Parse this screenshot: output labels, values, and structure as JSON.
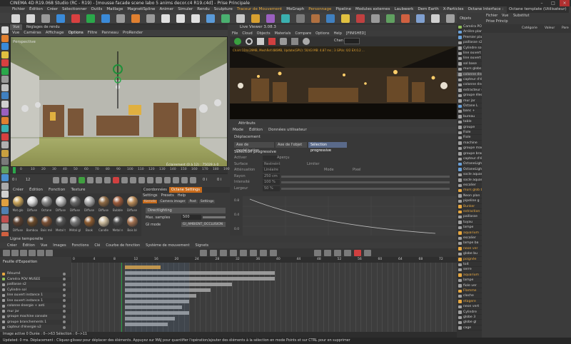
{
  "window": {
    "title": "CINEMA 4D R19.068 Studio (RC - R19) - [mousse facade scene labo 5 anims decor.c4 R19.c4d] - Prise Principale"
  },
  "menubar": [
    "Fichier",
    "Édition",
    "Créer",
    "Sélectionner",
    "Outils",
    "Maillage",
    "MagnetiSpline",
    "Animer",
    "Simuler",
    "Rendu",
    "Sculpture",
    "Traceur de Mouvement",
    "MoGraph",
    "Personnage",
    "Pipeline",
    "Modules externes",
    "Laubwerk",
    "Dem Earth",
    "X-Particles",
    "Octane",
    "Redshift",
    "Script",
    "Fenêtre",
    "Aide"
  ],
  "menubar_highlight": [
    "Traceur de Mouvement",
    "Personnage",
    "Fenêtre"
  ],
  "right_menubar": {
    "interface_label": "Interface :",
    "interface_value": "Octane template (Utilisateur)"
  },
  "viewport": {
    "tabs": [
      "Vue",
      "Réglages de rendu"
    ],
    "menu": [
      "Vue",
      "Caméras",
      "Affichage",
      "Options",
      "Filtre",
      "Panneau",
      "ProRender"
    ],
    "label": "Perspective",
    "overlay_text": "Éclairement (0 à 12) : 75029 à 0",
    "ruler_ticks": [
      "0",
      "10",
      "20",
      "30",
      "40",
      "50",
      "60",
      "70",
      "80",
      "90",
      "100",
      "110",
      "120",
      "130",
      "140",
      "150",
      "160",
      "170",
      "180",
      "190"
    ],
    "frame_start": "0 i",
    "frame_current": "12",
    "frame_end": "0 i",
    "fps_field": "0 i"
  },
  "live_viewer": {
    "title": "Live Viewer 3.08.3",
    "menu": [
      "File",
      "Cloud",
      "Objects",
      "Materials",
      "Compare",
      "Options",
      "Help",
      "[FINISHED]"
    ],
    "channel": "Chan",
    "status_text": "Chars:11to:29MB, MeshRef:486MB, Update(GPU): 50/43 MB: 4.87 ms ; 3 GPUs: 0/2 EX:0.2 ..."
  },
  "attributes": {
    "title": "Attributs",
    "menu": [
      "Mode",
      "Édition",
      "Données utilisateur"
    ],
    "object": "Déplacement",
    "tabs": [
      "Axe de modélisation",
      "Axe de l'objet",
      "Sélection progressive"
    ],
    "section": "Sélection progressive",
    "rows": [
      {
        "label": "Activer",
        "value": ""
      },
      {
        "label": "Surface",
        "value": "Restreint"
      },
      {
        "label": "Atténuation",
        "value": "Linéaire"
      },
      {
        "label": "Rayon",
        "value": "250 cm"
      },
      {
        "label": "Intensité",
        "value": "100 %"
      },
      {
        "label": "Largeur",
        "value": "50 %"
      }
    ],
    "extra_labels": [
      "Aperçu",
      "Limiter",
      "Mode",
      "Pixel"
    ],
    "graph_ticks": [
      "0.8",
      "0.4",
      "0.0"
    ]
  },
  "materials": {
    "menu": [
      "Créer",
      "Édition",
      "Fonction",
      "Texture"
    ],
    "items": [
      {
        "label": "Mat.glo",
        "color": "#c8a35a"
      },
      {
        "label": "Diffuse",
        "color": "#d8d8d8"
      },
      {
        "label": "Octane",
        "color": "#8a8a8a"
      },
      {
        "label": "Diffuse",
        "color": "#b9b9b9"
      },
      {
        "label": "Diffuse",
        "color": "#6a6a6a"
      },
      {
        "label": "Diffuse",
        "color": "#aaaaaa"
      },
      {
        "label": "Diffuse",
        "color": "#8f6b45"
      },
      {
        "label": "Bubble",
        "color": "#9b5a3a"
      },
      {
        "label": "Diffuse",
        "color": "#b88a58"
      },
      {
        "label": "Diffuse",
        "color": "#5a4030"
      },
      {
        "label": "Bambou",
        "color": "#6a4a2a"
      },
      {
        "label": "Bois mé",
        "color": "#7a5035"
      },
      {
        "label": "Metal t",
        "color": "#555555"
      },
      {
        "label": "Métal gl",
        "color": "#777777"
      },
      {
        "label": "Book",
        "color": "#8a5a30"
      },
      {
        "label": "Candle",
        "color": "#c8b89a"
      },
      {
        "label": "Metal n",
        "color": "#4a4a4a"
      },
      {
        "label": "Bois bl",
        "color": "#a07050"
      }
    ]
  },
  "octane_settings": {
    "tabs": [
      "Coordonnées",
      "Octane Settings"
    ],
    "subtabs": [
      "Settings",
      "Presets",
      "Help"
    ],
    "kernel_tabs": [
      "Kernels",
      "Camera imager",
      "Post",
      "Settings"
    ],
    "kernel": "Directlighting",
    "max_samples_label": "Max. samples",
    "max_samples_value": "500",
    "gi_mode_label": "GI mode",
    "gi_mode_value": "GI_AMBIENT_OCCLUSION"
  },
  "objects": {
    "tabs": [
      "Fichier",
      "Édition",
      "Vue"
    ],
    "header": "Objets",
    "rows": [
      {
        "label": "Caméra POV",
        "color": "#8fbf5a",
        "orange": false
      },
      {
        "label": "Arrière plan",
        "color": "#6aa0d8",
        "orange": false
      },
      {
        "label": "Premier plan",
        "color": "#6aa0d8",
        "orange": false
      },
      {
        "label": "paillasse s2",
        "color": "#a0a0a0",
        "orange": false
      },
      {
        "label": "Cylindre sol",
        "color": "#a0a0a0",
        "orange": false
      },
      {
        "label": "line ouvert",
        "color": "#a0a0a0",
        "orange": false
      },
      {
        "label": "line ouvert",
        "color": "#a0a0a0",
        "orange": false
      },
      {
        "label": "sol base",
        "color": "#a0a0a0",
        "orange": false
      },
      {
        "label": "murs globs",
        "color": "#a0a0a0",
        "orange": false
      },
      {
        "label": "colonne éne",
        "color": "#a0a0a0",
        "orange": false
      },
      {
        "label": "capteur d'é",
        "color": "#a0a0a0",
        "orange": false
      },
      {
        "label": "colonne éne",
        "color": "#a0a0a0",
        "orange": false
      },
      {
        "label": "extracteur d",
        "color": "#a0a0a0",
        "orange": false
      },
      {
        "label": "groupe élect",
        "color": "#a0a0a0",
        "orange": false
      },
      {
        "label": "mur jar",
        "color": "#a0a0a0",
        "orange": false
      },
      {
        "label": "Octane L",
        "color": "#6aa0d8",
        "orange": false
      },
      {
        "label": "banc +",
        "color": "#a0a0a0",
        "orange": false
      },
      {
        "label": "bureau",
        "color": "#a0a0a0",
        "orange": false
      },
      {
        "label": "table",
        "color": "#a0a0a0",
        "orange": false
      },
      {
        "label": "groupe",
        "color": "#a0a0a0",
        "orange": false
      },
      {
        "label": "Fiole",
        "color": "#a0a0a0",
        "orange": false
      },
      {
        "label": "Fiole",
        "color": "#a0a0a0",
        "orange": false
      },
      {
        "label": "machine",
        "color": "#a0a0a0",
        "orange": false
      },
      {
        "label": "groupe machi",
        "color": "#a0a0a0",
        "orange": false
      },
      {
        "label": "groupe bran",
        "color": "#a0a0a0",
        "orange": false
      },
      {
        "label": "capteur d'é",
        "color": "#a0a0a0",
        "orange": false
      },
      {
        "label": "OctaneLight",
        "color": "#6aa0d8",
        "orange": false
      },
      {
        "label": "OctaneLight",
        "color": "#6aa0d8",
        "orange": false
      },
      {
        "label": "socle aquari",
        "color": "#a0a0a0",
        "orange": false
      },
      {
        "label": "socle aquari",
        "color": "#a0a0a0",
        "orange": false
      },
      {
        "label": "escalier",
        "color": "#a0a0a0",
        "orange": false
      },
      {
        "label": "murs glob b",
        "color": "#e8a840",
        "orange": true
      },
      {
        "label": "Neon plan",
        "color": "#a0a0a0",
        "orange": false
      },
      {
        "label": "pipeline g",
        "color": "#a0a0a0",
        "orange": false
      },
      {
        "label": "Bunker",
        "color": "#e8a840",
        "orange": true
      },
      {
        "label": "extraction",
        "color": "#e8a840",
        "orange": true
      },
      {
        "label": "paillasse",
        "color": "#a0a0a0",
        "orange": false
      },
      {
        "label": "tuyau",
        "color": "#a0a0a0",
        "orange": false
      },
      {
        "label": "lampe",
        "color": "#a0a0a0",
        "orange": false
      },
      {
        "label": "aquarium",
        "color": "#e8a840",
        "orange": true
      },
      {
        "label": "escalier",
        "color": "#a0a0a0",
        "orange": false
      },
      {
        "label": "lampe ba",
        "color": "#a0a0a0",
        "orange": false
      },
      {
        "label": "neon ver",
        "color": "#e8a840",
        "orange": true
      },
      {
        "label": "globe bu",
        "color": "#a0a0a0",
        "orange": false
      },
      {
        "label": "poignée",
        "color": "#e8a840",
        "orange": true
      },
      {
        "label": "toit",
        "color": "#a0a0a0",
        "orange": false
      },
      {
        "label": "serre",
        "color": "#a0a0a0",
        "orange": false
      },
      {
        "label": "aquarium",
        "color": "#e8a840",
        "orange": true
      },
      {
        "label": "lampe",
        "color": "#a0a0a0",
        "orange": false
      },
      {
        "label": "fiole ver",
        "color": "#a0a0a0",
        "orange": false
      },
      {
        "label": "Flamme",
        "color": "#e8a840",
        "orange": true
      },
      {
        "label": "cloche",
        "color": "#a0a0a0",
        "orange": false
      },
      {
        "label": "etagere",
        "color": "#e8a840",
        "orange": true
      },
      {
        "label": "neon vert",
        "color": "#a0a0a0",
        "orange": false
      },
      {
        "label": "Cylindre",
        "color": "#a0a0a0",
        "orange": false
      },
      {
        "label": "globe 3",
        "color": "#a0a0a0",
        "orange": false
      },
      {
        "label": "globe gl",
        "color": "#a0a0a0",
        "orange": false
      },
      {
        "label": "cage",
        "color": "#a0a0a0",
        "orange": false
      }
    ]
  },
  "layers": {
    "tabs": [
      "Fichier",
      "Vue",
      "Substitut",
      "Prise Princip"
    ],
    "columns": [
      "Catégorie",
      "Valeur",
      "Pare"
    ]
  },
  "dope_sheet": {
    "title": "Ligne temporelle",
    "menu": [
      "Créer",
      "Édition",
      "Vue",
      "Images",
      "Fonctions",
      "Clé",
      "Courbe de fonction",
      "Système de mouvement",
      "Signets"
    ],
    "section": "Feuille d'Exposition",
    "ruler": [
      "0",
      "4",
      "8",
      "12",
      "16",
      "20",
      "24",
      "28",
      "32",
      "36",
      "40",
      "44",
      "48",
      "52",
      "56",
      "60",
      "64",
      "68",
      "72"
    ],
    "tracks": [
      {
        "label": "Résumé",
        "color": "#e8a840"
      },
      {
        "label": "Caméra POV MUSEE",
        "color": "#8fbf5a"
      },
      {
        "label": "paillasse s2",
        "color": "#a0a0a0"
      },
      {
        "label": "Cylindre sol",
        "color": "#a0a0a0"
      },
      {
        "label": "line ouvert instance 1",
        "color": "#a0a0a0"
      },
      {
        "label": "line ouvert instance 1",
        "color": "#a0a0a0"
      },
      {
        "label": "colonne énergie + anti",
        "color": "#a0a0a0"
      },
      {
        "label": "mur jar",
        "color": "#a0a0a0"
      },
      {
        "label": "groupe machine console",
        "color": "#a0a0a0"
      },
      {
        "label": "groupe branchements 1",
        "color": "#a0a0a0"
      },
      {
        "label": "capteur d'énergie v2",
        "color": "#a0a0a0"
      }
    ]
  },
  "status": {
    "line1": "Image active  0  Durée : 0-->63   Sélection : 0-->11",
    "line2": "Updated: 0 ms.   Déplacement : Cliquez-glissez pour déplacer des éléments. Appuyez sur MAJ pour quantifier l'opération/ajouter des éléments à la sélection en mode Points et sur CTRL pour en supprimer"
  }
}
